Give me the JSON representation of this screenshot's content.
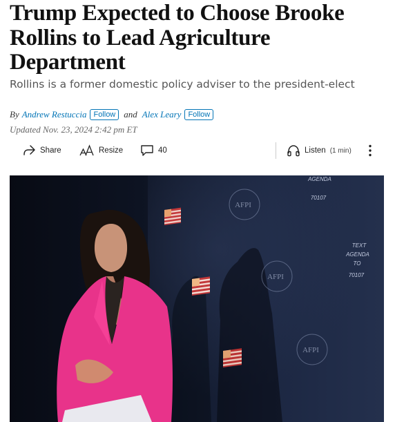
{
  "article": {
    "headline": "Trump Expected to Choose Brooke Rollins to Lead Agriculture Department",
    "dek": "Rollins is a former domestic policy adviser to the president-elect",
    "byline": {
      "by": "By",
      "author1": "Andrew Restuccia",
      "follow1": "Follow",
      "and": "and",
      "author2": "Alex Leary",
      "follow2": "Follow"
    },
    "updated": "Updated Nov. 23, 2024 2:42 pm ET"
  },
  "toolbar": {
    "share_label": "Share",
    "share_icon": "share-arrow-icon",
    "resize_label": "Resize",
    "resize_icon": "text-size-icon",
    "comments_count": "40",
    "comments_icon": "comment-bubble-icon",
    "listen_label": "Listen",
    "listen_duration": "(1 min)",
    "listen_icon": "headphones-icon",
    "more_icon": "vertical-ellipsis-icon"
  },
  "photo": {
    "backdrop_text": {
      "top": [
        "AGENDA",
        "70107"
      ],
      "right": [
        "TEXT",
        "AGENDA",
        "TO",
        "70107"
      ],
      "logo": "AFPI"
    }
  },
  "colors": {
    "link": "#0274b6",
    "headline": "#111111",
    "dek": "#555555",
    "blazer": "#e8338a",
    "backdrop": "#16203a"
  }
}
